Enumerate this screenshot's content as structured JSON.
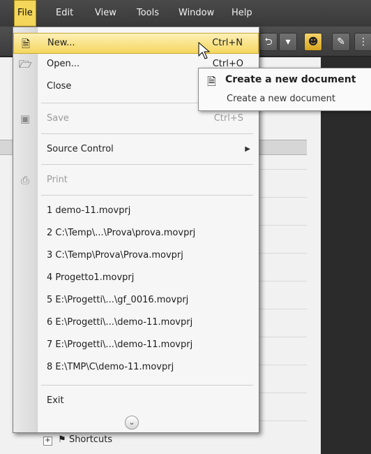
{
  "menubar": {
    "items": [
      {
        "label": "File"
      },
      {
        "label": "Edit"
      },
      {
        "label": "View"
      },
      {
        "label": "Tools"
      },
      {
        "label": "Window"
      },
      {
        "label": "Help"
      }
    ]
  },
  "file_menu": {
    "new": {
      "label": "New...",
      "shortcut": "Ctrl+N"
    },
    "open": {
      "label": "Open...",
      "shortcut": "Ctrl+O"
    },
    "close": {
      "label": "Close"
    },
    "save": {
      "label": "Save",
      "shortcut": "Ctrl+S"
    },
    "source_control": {
      "label": "Source Control"
    },
    "print": {
      "label": "Print"
    },
    "recent": [
      {
        "label": "1 demo-11.movprj"
      },
      {
        "label": "2 C:\\Temp\\...\\Prova\\prova.movprj"
      },
      {
        "label": "3 C:\\Temp\\Prova\\Prova.movprj"
      },
      {
        "label": "4 Progetto1.movprj"
      },
      {
        "label": "5 E:\\Progetti\\...\\gf_0016.movprj"
      },
      {
        "label": "6 E:\\Progetti\\...\\demo-11.movprj"
      },
      {
        "label": "7 E:\\Progetti\\...\\demo-11.movprj"
      },
      {
        "label": "8 E:\\TMP\\C\\demo-11.movprj"
      }
    ],
    "exit": {
      "label": "Exit"
    }
  },
  "tooltip": {
    "title": "Create a new document",
    "description": "Create a new document"
  },
  "tree": {
    "shortcuts": "Shortcuts"
  },
  "icons": {
    "new": "new-document-icon",
    "open": "open-folder-icon",
    "save": "save-disk-icon",
    "print": "printer-icon",
    "submenu": "chevron-right-icon",
    "expand": "chevron-double-down-icon"
  }
}
